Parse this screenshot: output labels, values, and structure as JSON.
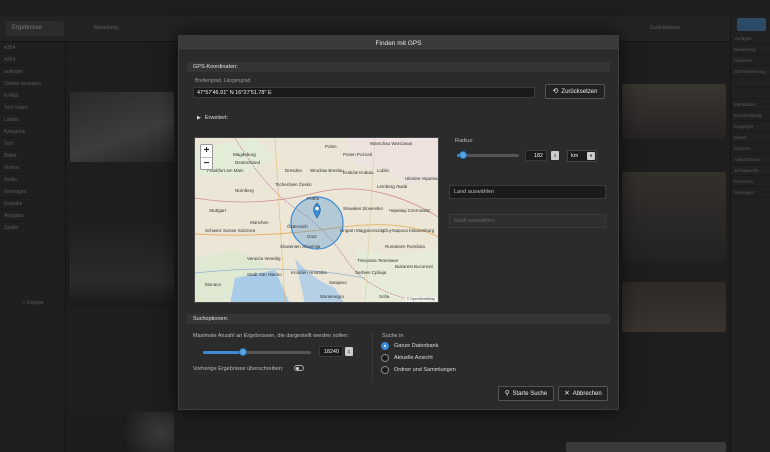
{
  "dialog": {
    "title": "Finden mit GPS",
    "gps_section": "GPS-Koordinaten:",
    "coord_label": "Breitengrad, Längengrad",
    "coord_value": "47°57'46.91\" N 16°27'51.78\" E",
    "reset_label": "Zurücksetzen",
    "advanced_label": "Erweitert:",
    "radius_label": "Radius:",
    "radius_value": 182,
    "radius_slider_fraction": 0.1,
    "radius_unit": "km",
    "country_placeholder": "Land auswählen",
    "city_placeholder": "Stadt auswählen",
    "search_section": "Suchoptionen:",
    "max_results_label": "Maximale Anzahl an Ergebnissen, die dargestellt werden sollen:",
    "max_results_value": 18240,
    "max_results_slider_fraction": 0.37,
    "overwrite_label": "Vorherige Ergebnisse überschreiben:",
    "search_in_label": "Suche in",
    "search_in_options": [
      "Ganze Datenbank",
      "Aktuelle Ansicht",
      "Ordner und Sammlungen"
    ],
    "search_in_selected": "Ganze Datenbank",
    "start_search_label": "Starte Suche",
    "cancel_label": "Abbrechen"
  },
  "map": {
    "zoom_in": "+",
    "zoom_out": "−",
    "attribution": "© OpenStreetMap",
    "places": [
      "Polen",
      "Warschau Warszawa",
      "Posen Poznań",
      "Magdeburg",
      "Deutschland",
      "Dresden",
      "Wrocław Breslau",
      "Kraków Krakau",
      "Lublin",
      "Frankfurt am Main",
      "Nürnberg",
      "Tschechien Česko",
      "Lemberg Львів",
      "Ukraine Україна",
      "Stuttgart",
      "München",
      "Slowakei Slovensko",
      "Чернівці Czernowitz",
      "Cluj-Napoca Klausenburg",
      "Schweiz Suisse Svizzera",
      "Slowenien Slovenija",
      "Ungarn Magyarország",
      "Rumänien România",
      "Venezia Venedig",
      "Stadt San Marino",
      "Kroatien Hrvatska",
      "Sarajevo",
      "Timișoara Temeswar",
      "Serbien Србија",
      "Bukarest București",
      "Monaco",
      "Montenegro",
      "Sofia",
      "Graz",
      "Österreich",
      "Praha"
    ],
    "accent": "#3d8bd4"
  },
  "background": {
    "logo": "Ergebnisse",
    "filter": "Bewertung",
    "action": "Zurücksetzen",
    "group_button": "+ Gruppe",
    "left_rows": [
      "4354",
      "4354",
      "auflegen",
      "Ordner anzeigen",
      "E-Mail",
      "Text Video",
      "Labels",
      "Kategorie",
      "Text",
      "Bilder",
      "Videos",
      "Audio",
      "Sonstiges",
      "Eingabe",
      "Ausgabe",
      "Spalte"
    ],
    "right_rows": [
      "Vorlagen",
      "Bewertung",
      "Aktionen",
      "Sternbewertung",
      "",
      "",
      "Metadaten",
      "Beschreibung",
      "Copyright",
      "Datum",
      "Kamera",
      "Aufnahmeort",
      "Schlagworte",
      "Personen",
      "Sonstiges"
    ]
  }
}
